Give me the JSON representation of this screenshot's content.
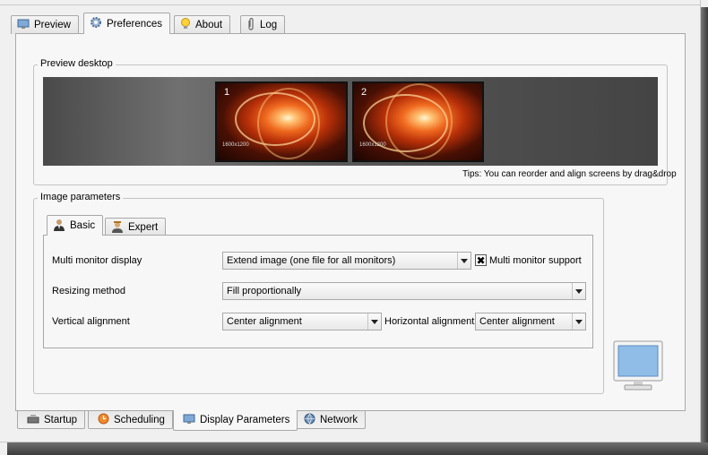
{
  "tabs": [
    {
      "label": "Preview",
      "icon": "monitor-icon"
    },
    {
      "label": "Preferences",
      "icon": "gear-icon"
    },
    {
      "label": "About",
      "icon": "lightbulb-icon"
    },
    {
      "label": "Log",
      "icon": "paperclip-icon"
    }
  ],
  "preview_group": {
    "title": "Preview  desktop",
    "screens": [
      {
        "number": "1",
        "resolution": "1600x1200"
      },
      {
        "number": "2",
        "resolution": "1600x1200"
      }
    ],
    "tips": "Tips: You can reorder and align screens by drag&drop"
  },
  "image_group": {
    "title": "Image parameters",
    "subtabs": [
      {
        "label": "Basic",
        "icon": "user-icon"
      },
      {
        "label": "Expert",
        "icon": "expert-user-icon"
      }
    ],
    "multi_monitor_label": "Multi monitor display",
    "multi_monitor_value": "Extend image (one file for all monitors)",
    "multi_monitor_support_label": "Multi monitor support",
    "resizing_label": "Resizing method",
    "resizing_value": "Fill proportionally",
    "vertical_label": "Vertical alignment",
    "vertical_value": "Center alignment",
    "horizontal_label": "Horizontal alignment",
    "horizontal_value": "Center alignment"
  },
  "bottom_tabs": [
    {
      "label": "Startup",
      "icon": "startup-icon"
    },
    {
      "label": "Scheduling",
      "icon": "clock-icon"
    },
    {
      "label": "Display Parameters",
      "icon": "monitor-icon"
    },
    {
      "label": "Network",
      "icon": "globe-icon"
    }
  ]
}
